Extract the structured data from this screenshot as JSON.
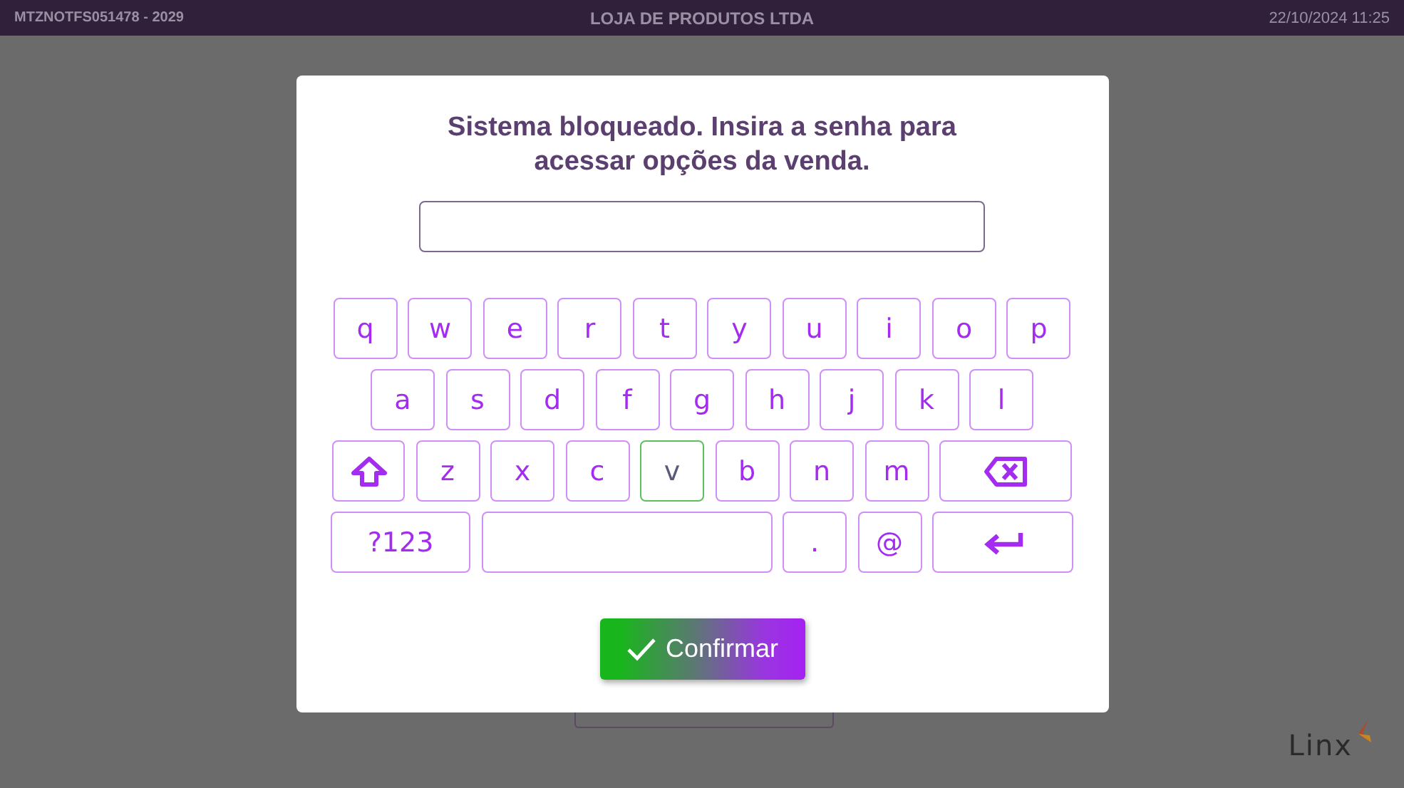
{
  "top_bar": {
    "terminal": "MTZNOTFS051478 - 2029",
    "store": "LOJA DE PRODUTOS LTDA",
    "datetime": "22/10/2024 11:25"
  },
  "dialog": {
    "message": "Sistema bloqueado. Insira a senha para acessar opções da venda.",
    "keyboard": {
      "rows": [
        {
          "keys": [
            {
              "kind": "char",
              "label": "q",
              "highlighted": false
            },
            {
              "kind": "char",
              "label": "w",
              "highlighted": false
            },
            {
              "kind": "char",
              "label": "e",
              "highlighted": false
            },
            {
              "kind": "char",
              "label": "r",
              "highlighted": false
            },
            {
              "kind": "char",
              "label": "t",
              "highlighted": false
            },
            {
              "kind": "char",
              "label": "y",
              "highlighted": false
            },
            {
              "kind": "char",
              "label": "u",
              "highlighted": false
            },
            {
              "kind": "char",
              "label": "i",
              "highlighted": false
            },
            {
              "kind": "char",
              "label": "o",
              "highlighted": false
            },
            {
              "kind": "char",
              "label": "p",
              "highlighted": false
            }
          ]
        },
        {
          "keys": [
            {
              "kind": "char",
              "label": "a",
              "highlighted": false
            },
            {
              "kind": "char",
              "label": "s",
              "highlighted": false
            },
            {
              "kind": "char",
              "label": "d",
              "highlighted": false
            },
            {
              "kind": "char",
              "label": "f",
              "highlighted": false
            },
            {
              "kind": "char",
              "label": "g",
              "highlighted": false
            },
            {
              "kind": "char",
              "label": "h",
              "highlighted": false
            },
            {
              "kind": "char",
              "label": "j",
              "highlighted": false
            },
            {
              "kind": "char",
              "label": "k",
              "highlighted": false
            },
            {
              "kind": "char",
              "label": "l",
              "highlighted": false
            }
          ]
        },
        {
          "keys": [
            {
              "kind": "shift",
              "highlighted": false
            },
            {
              "kind": "char",
              "label": "z",
              "highlighted": false
            },
            {
              "kind": "char",
              "label": "x",
              "highlighted": false
            },
            {
              "kind": "char",
              "label": "c",
              "highlighted": false
            },
            {
              "kind": "char",
              "label": "v",
              "highlighted": true
            },
            {
              "kind": "char",
              "label": "b",
              "highlighted": false
            },
            {
              "kind": "char",
              "label": "n",
              "highlighted": false
            },
            {
              "kind": "char",
              "label": "m",
              "highlighted": false
            },
            {
              "kind": "backspace",
              "highlighted": false
            }
          ]
        },
        {
          "keys": [
            {
              "kind": "mode",
              "label": "?123",
              "highlighted": false
            },
            {
              "kind": "space",
              "highlighted": false
            },
            {
              "kind": "char",
              "label": ".",
              "highlighted": false
            },
            {
              "kind": "char",
              "label": "@",
              "highlighted": false
            },
            {
              "kind": "enter",
              "highlighted": false
            }
          ]
        }
      ]
    },
    "confirm_button": {
      "label": "Confirmar"
    }
  },
  "logo": {
    "text": "Linx"
  }
}
